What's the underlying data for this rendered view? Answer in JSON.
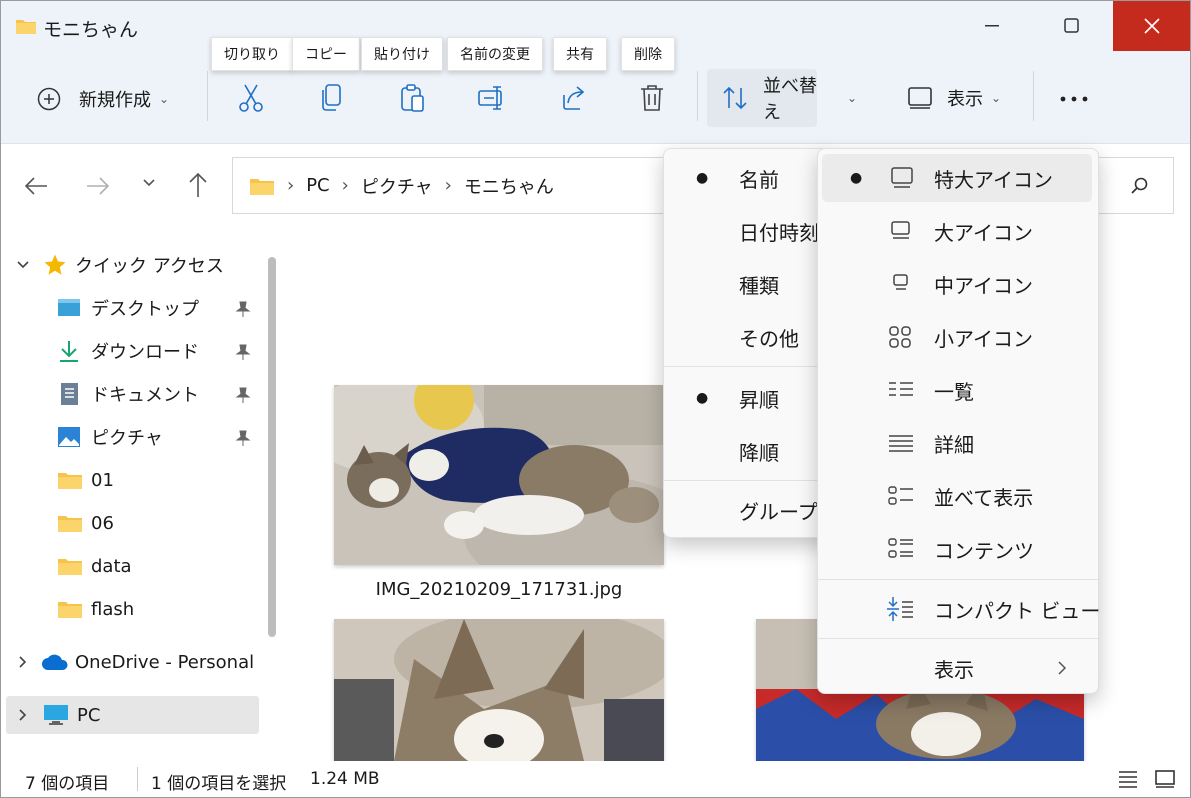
{
  "window": {
    "title": "モニちゃん",
    "minimize_icon": "minimize-icon",
    "maximize_icon": "maximize-icon",
    "close_icon": "close-icon",
    "close_color": "#c42b1c"
  },
  "toolbar": {
    "new_label": "新規作成",
    "tooltips": [
      "切り取り",
      "コピー",
      "貼り付け",
      "名前の変更",
      "共有",
      "削除"
    ],
    "sort_label": "並べ替え",
    "view_label": "表示",
    "more_icon": "more-icon"
  },
  "nav": {
    "breadcrumb": [
      "PC",
      "ピクチャ",
      "モニちゃん"
    ]
  },
  "sidebar": {
    "quick_access": "クイック アクセス",
    "items": [
      {
        "label": "デスクトップ",
        "icon": "desktop-icon",
        "pinned": true
      },
      {
        "label": "ダウンロード",
        "icon": "download-icon",
        "pinned": true
      },
      {
        "label": "ドキュメント",
        "icon": "document-icon",
        "pinned": true
      },
      {
        "label": "ピクチャ",
        "icon": "pictures-icon",
        "pinned": true
      },
      {
        "label": "01",
        "icon": "folder-icon",
        "pinned": false
      },
      {
        "label": "06",
        "icon": "folder-icon",
        "pinned": false
      },
      {
        "label": "data",
        "icon": "folder-icon",
        "pinned": false
      },
      {
        "label": "flash",
        "icon": "folder-icon",
        "pinned": false
      }
    ],
    "onedrive": "OneDrive - Personal",
    "pc": "PC"
  },
  "content": {
    "files": [
      {
        "name": "IMG_20210209_171731.jpg"
      }
    ]
  },
  "status": {
    "count": "7 個の項目",
    "selection": "1 個の項目を選択",
    "size": "1.24 MB"
  },
  "sort_menu": {
    "items": [
      "名前",
      "日付時刻",
      "種類",
      "その他"
    ],
    "order": [
      "昇順",
      "降順"
    ],
    "group": "グループ化"
  },
  "view_menu": {
    "items": [
      {
        "label": "特大アイコン",
        "icon": "extra-large-icons-icon",
        "selected": true
      },
      {
        "label": "大アイコン",
        "icon": "large-icons-icon",
        "selected": false
      },
      {
        "label": "中アイコン",
        "icon": "medium-icons-icon",
        "selected": false
      },
      {
        "label": "小アイコン",
        "icon": "small-icons-icon",
        "selected": false
      },
      {
        "label": "一覧",
        "icon": "list-icon",
        "selected": false
      },
      {
        "label": "詳細",
        "icon": "details-icon",
        "selected": false
      },
      {
        "label": "並べて表示",
        "icon": "tiles-icon",
        "selected": false
      },
      {
        "label": "コンテンツ",
        "icon": "content-icon",
        "selected": false
      }
    ],
    "compact": "コンパクト ビュー",
    "show": "表示"
  }
}
